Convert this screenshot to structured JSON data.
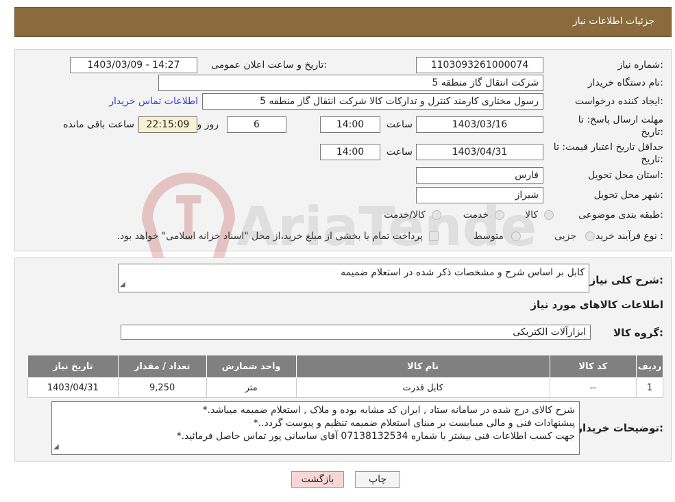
{
  "header": {
    "title": "جزئیات اطلاعات نیاز"
  },
  "fields": {
    "need_number_label": "شماره نیاز:",
    "need_number": "1103093261000074",
    "announce_label": "تاریخ و ساعت اعلان عمومی:",
    "announce_value": "1403/03/09 - 14:27",
    "buyer_org_label": "نام دستگاه خریدار:",
    "buyer_org": "شرکت انتقال گاز منطقه 5",
    "creator_label": "ایجاد کننده درخواست:",
    "creator": "رسول  مختاری کارمند کنترل و تدارکات کالا شرکت انتقال گاز منطقه 5",
    "contact_link": "اطلاعات تماس خریدار",
    "reply_deadline_label": "مهلت ارسال پاسخ: تا تاریخ:",
    "reply_date": "1403/03/16",
    "time_word": "ساعت",
    "reply_time": "14:00",
    "days_value": "6",
    "days_word": "روز و",
    "remaining_value": "22:15:09",
    "remaining_word": "ساعت باقی مانده",
    "price_validity_label": "حداقل تاریخ اعتبار قیمت: تا تاریخ:",
    "price_date": "1403/04/31",
    "price_time": "14:00",
    "province_label": "استان محل تحویل:",
    "province": "فارس",
    "city_label": "شهر محل تحویل:",
    "city": "شیراز",
    "category_label": "طبقه بندی موضوعی:",
    "category_options": [
      "کالا",
      "خدمت",
      "کالا/خدمت"
    ],
    "purchase_type_label": "نوع فرآیند خرید :",
    "purchase_options": [
      "جزیی",
      "متوسط"
    ],
    "purchase_note": "پرداخت تمام یا بخشی از مبلغ خرید،از محل \"اسناد خزانه اسلامی\" خواهد بود."
  },
  "general": {
    "description_label": "شرح کلی نیاز:",
    "description": "کابل بر اساس شرح و مشخصات ذکر شده در استعلام ضمیمه",
    "items_title": "اطلاعات کالاهای مورد نیاز",
    "group_label": "گروه کالا:",
    "group_value": "ابزارآلات الکتریکی"
  },
  "table": {
    "headers": [
      "ردیف",
      "کد کالا",
      "نام کالا",
      "واحد شمارش",
      "تعداد / مقدار",
      "تاریخ نیاز"
    ],
    "rows": [
      [
        "1",
        "--",
        "کابل قدرت",
        "متر",
        "9,250",
        "1403/04/31"
      ]
    ]
  },
  "buyer_notes": {
    "label": "توضیحات خریدار:",
    "line1": "شرح کالای درج شده در سامانه ستاد , ایران کد مشابه بوده و ملاک , استعلام ضمیمه میباشد.*",
    "line2": "پیشنهادات فنی و مالی میبایست بر مبنای استعلام ضمیمه تنظیم و پیوست گردد..*",
    "line3": "جهت کسب اطلاعات فنی بیشتر با شماره 07138132534 آقای ساسانی پور تماس حاصل فرمائید.*"
  },
  "buttons": {
    "print": "چاپ",
    "back": "بازگشت"
  },
  "watermark": {
    "text": "AriaTender.neT"
  },
  "colors": {
    "header": "#8b6a3e",
    "table_header": "#808080",
    "link": "#2b3fd6",
    "back_button": "#f6d6d6"
  }
}
